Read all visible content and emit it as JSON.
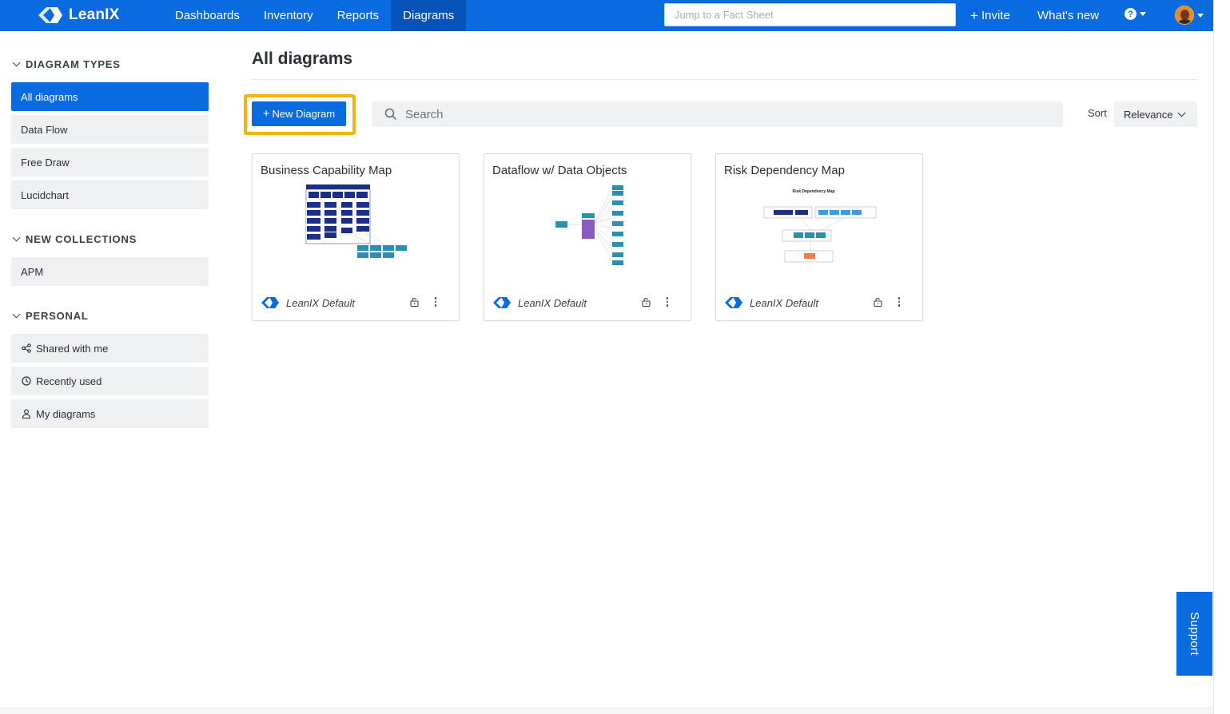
{
  "brand": {
    "name": "LeanIX",
    "color": "#0a6ae0",
    "highlight": "#f5b40c"
  },
  "topnav": {
    "items": [
      {
        "label": "Dashboards",
        "active": false
      },
      {
        "label": "Inventory",
        "active": false
      },
      {
        "label": "Reports",
        "active": false
      },
      {
        "label": "Diagrams",
        "active": true
      }
    ],
    "search_placeholder": "Jump to a Fact Sheet",
    "invite_label": "Invite",
    "whats_new_label": "What's new",
    "help_icon": "question-circle-icon"
  },
  "sidebar": {
    "sections": [
      {
        "title": "DIAGRAM TYPES",
        "items": [
          {
            "label": "All diagrams",
            "active": true,
            "icon": ""
          },
          {
            "label": "Data Flow",
            "active": false,
            "icon": ""
          },
          {
            "label": "Free Draw",
            "active": false,
            "icon": ""
          },
          {
            "label": "Lucidchart",
            "active": false,
            "icon": ""
          }
        ]
      },
      {
        "title": "NEW COLLECTIONS",
        "items": [
          {
            "label": "APM",
            "active": false,
            "icon": ""
          }
        ]
      },
      {
        "title": "PERSONAL",
        "items": [
          {
            "label": "Shared with me",
            "active": false,
            "icon": "share-icon"
          },
          {
            "label": "Recently used",
            "active": false,
            "icon": "clock-icon"
          },
          {
            "label": "My diagrams",
            "active": false,
            "icon": "user-icon"
          }
        ]
      }
    ]
  },
  "main": {
    "title": "All diagrams",
    "new_button_label": "New Diagram",
    "search_placeholder": "Search",
    "sort_label": "Sort",
    "sort_value": "Relevance",
    "cards": [
      {
        "title": "Business Capability Map",
        "owner": "LeanIX Default",
        "thumb_title": ""
      },
      {
        "title": "Dataflow w/ Data Objects",
        "owner": "LeanIX Default",
        "thumb_title": ""
      },
      {
        "title": "Risk Dependency Map",
        "owner": "LeanIX Default",
        "thumb_title": "Risk Dependency Map"
      }
    ]
  },
  "support_label": "Support"
}
